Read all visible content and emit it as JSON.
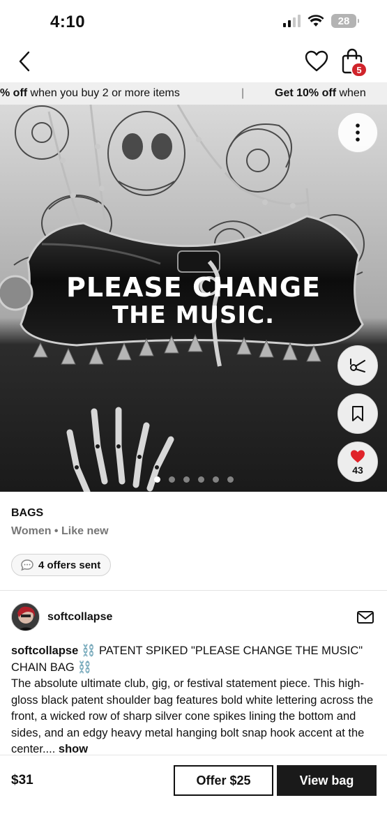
{
  "status_bar": {
    "time": "4:10",
    "battery": "28"
  },
  "nav": {
    "cart_count": "5"
  },
  "promo": {
    "left_bold": "% off",
    "left_text": " when you buy 2 or more items",
    "separator": "|",
    "right_text_prefix": "Get ",
    "right_bold": "10% off",
    "right_text": " when"
  },
  "hero": {
    "bag_text_line1": "PLEASE CHANGE",
    "bag_text_line2": "THE MUSIC.",
    "like_count": "43",
    "dots_count": 6,
    "active_dot": 0
  },
  "listing": {
    "category": "BAGS",
    "meta": "Women • Like new",
    "offers": "4 offers sent"
  },
  "seller": {
    "username": "softcollapse"
  },
  "description": {
    "username": "softcollapse",
    "title": " ⛓️ PATENT SPIKED \"PLEASE CHANGE THE MUSIC\" CHAIN BAG ⛓️",
    "body": "The absolute ultimate club, gig, or festival statement piece. This high-gloss black patent shoulder bag features bold white lettering across the front, a wicked row of sharp silver cone spikes lining the bottom and sides, and an edgy heavy metal hanging bolt snap hook accent at the center....",
    "show_more": "show"
  },
  "bottom": {
    "price": "$31",
    "offer_label": "Offer $25",
    "view_label": "View bag"
  },
  "colors": {
    "badge": "#d0242b",
    "like": "#e0232a",
    "dark_button": "#1a1a1a"
  }
}
